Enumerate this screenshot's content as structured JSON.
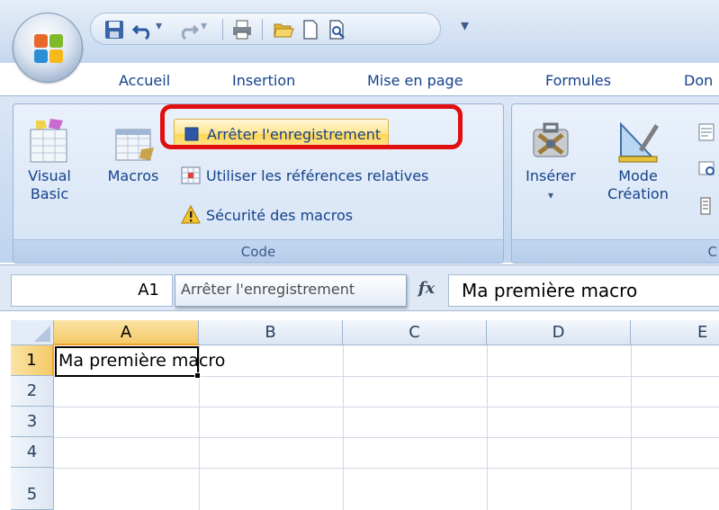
{
  "ribbon": {
    "tabs": [
      "Accueil",
      "Insertion",
      "Mise en page",
      "Formules",
      "Don"
    ],
    "code_group": {
      "title": "Code",
      "visual_basic_label": "Visual\nBasic",
      "macros_label": "Macros",
      "stop_recording_label": "Arrêter l'enregistrement",
      "relative_refs_label": "Utiliser les références relatives",
      "macro_security_label": "Sécurité des macros"
    },
    "controls_group": {
      "insert_label": "Insérer",
      "insert_arrow": "▾",
      "design_mode_label": "Mode\nCréation",
      "title_partial": "C"
    }
  },
  "qat": {
    "more_glyph": "▾"
  },
  "formula_bar": {
    "name_box": "A1",
    "tooltip": "Arrêter l'enregistrement",
    "fx": "fx",
    "formula": "Ma première macro"
  },
  "sheet": {
    "columns": [
      "A",
      "B",
      "C",
      "D",
      "E"
    ],
    "rows": [
      "1",
      "2",
      "3",
      "4",
      "5"
    ],
    "active_cell": "A1",
    "cells": {
      "A1": "Ma première macro"
    }
  },
  "colors": {
    "highlight_ring": "#e01010",
    "active_header": "#f4c967",
    "ribbon_text": "#15428b"
  }
}
